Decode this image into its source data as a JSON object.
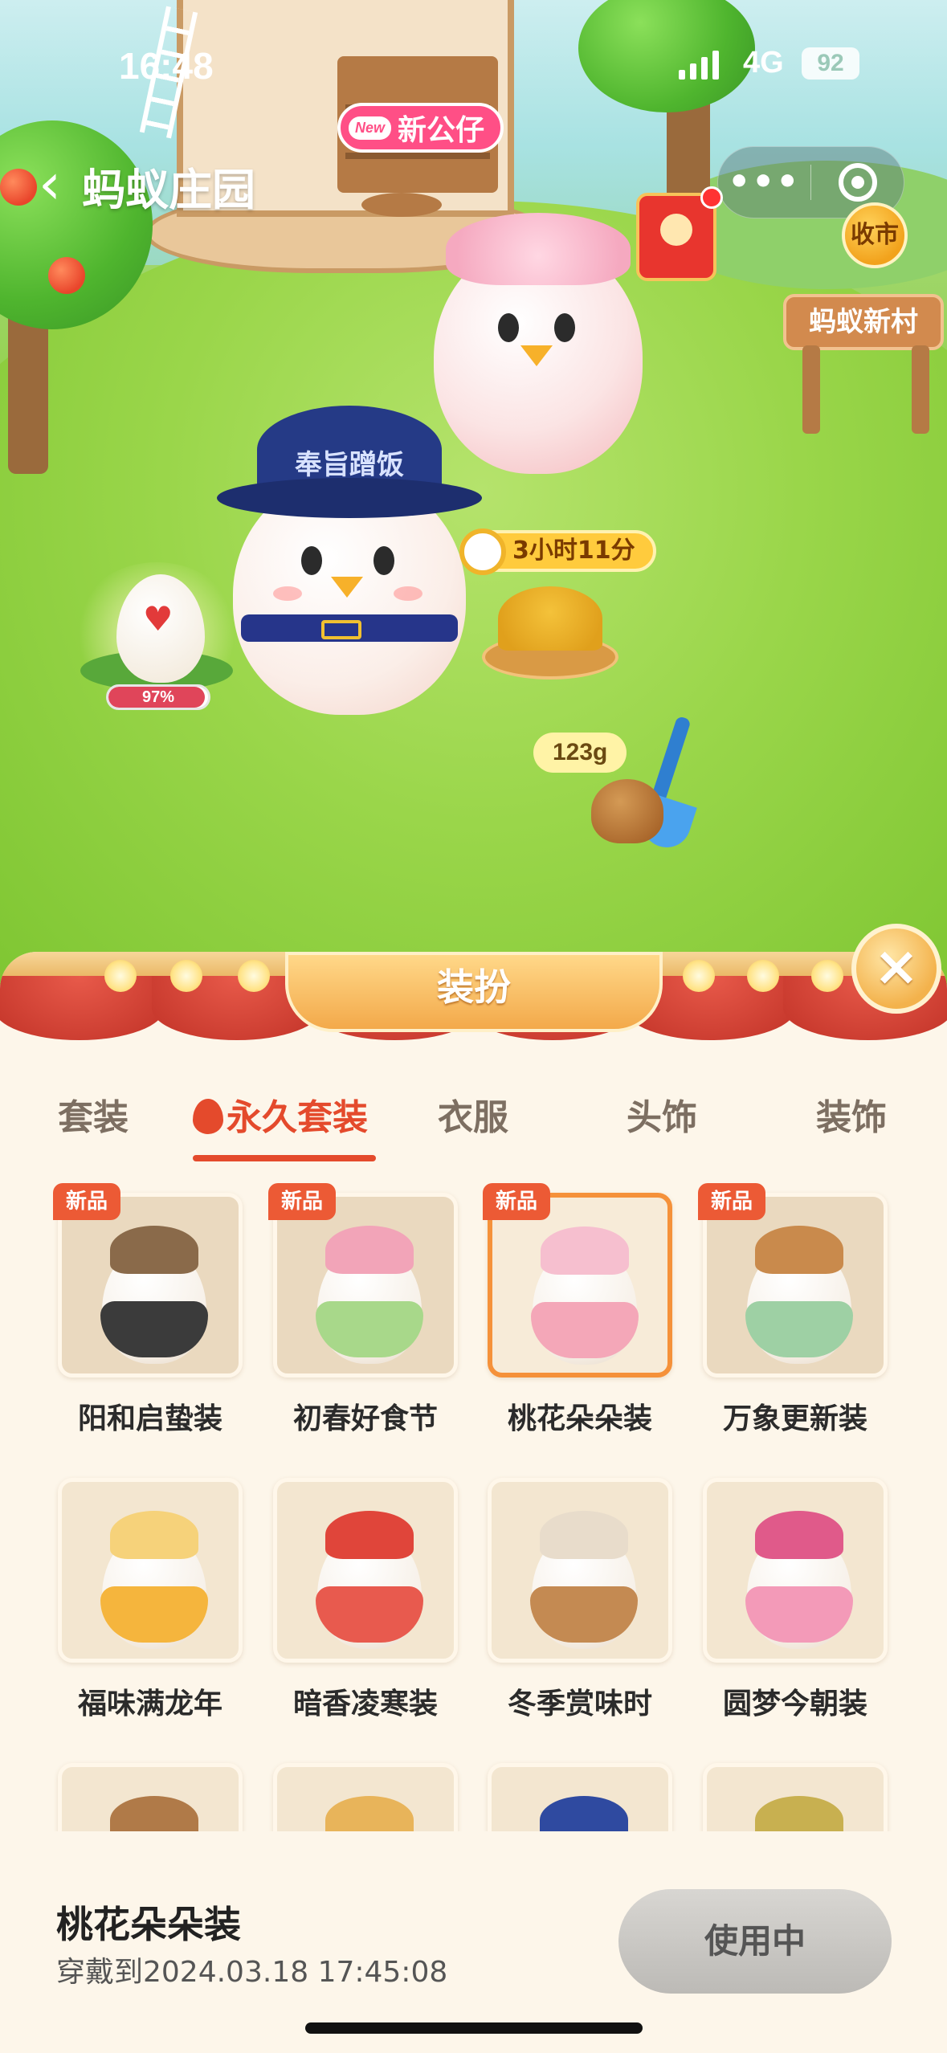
{
  "status_bar": {
    "time": "16:48",
    "network": "4G",
    "battery": "92"
  },
  "nav": {
    "back_icon": "chevron-left-icon",
    "title": "蚂蚁庄园",
    "more_icon": "more-dots-icon",
    "close_icon": "target-circle-icon"
  },
  "scene": {
    "new_character_badge": {
      "tag": "New",
      "label": "新公仔"
    },
    "market_button": "收市",
    "village_sign": "蚂蚁新村",
    "pirate_hat_text": "奉旨蹭饭",
    "feeding_timer": "3小时11分",
    "egg_progress": {
      "text": "97%",
      "value": 0.97
    },
    "manure_weight": "123g"
  },
  "panel": {
    "title": "装扮",
    "close_label": "×",
    "tabs": [
      {
        "label": "套装",
        "active": false
      },
      {
        "label": "永久套装",
        "active": true
      },
      {
        "label": "衣服",
        "active": false
      },
      {
        "label": "头饰",
        "active": false
      },
      {
        "label": "装饰",
        "active": false
      }
    ],
    "new_tag": "新品",
    "items": [
      {
        "name": "阳和启蛰装",
        "new": true,
        "selected": false
      },
      {
        "name": "初春好食节",
        "new": true,
        "selected": false
      },
      {
        "name": "桃花朵朵装",
        "new": true,
        "selected": true
      },
      {
        "name": "万象更新装",
        "new": true,
        "selected": false
      },
      {
        "name": "福味满龙年",
        "new": false,
        "selected": false
      },
      {
        "name": "暗香凌寒装",
        "new": false,
        "selected": false
      },
      {
        "name": "冬季赏味时",
        "new": false,
        "selected": false
      },
      {
        "name": "圆梦今朝装",
        "new": false,
        "selected": false
      }
    ]
  },
  "selection": {
    "name": "桃花朵朵装",
    "wear_until": "穿戴到2024.03.18 17:45:08",
    "action_button": "使用中"
  },
  "colors": {
    "accent": "#e44a2c",
    "new_tag": "#ec5a35",
    "selected_border": "#f5913a",
    "panel_bg": "#fdf6ea"
  }
}
